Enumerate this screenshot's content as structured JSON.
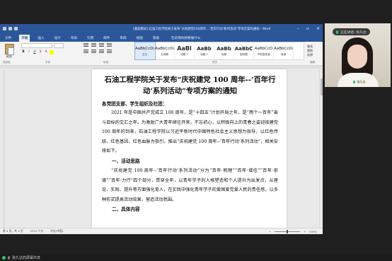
{
  "word": {
    "title": "[兼容模式] 石油工程学院关于发布“庆祝建党100周年…‘百年行动’系列活动”专项方案的通知 - Word",
    "tabs": [
      "文件",
      "开始",
      "插入",
      "设计",
      "布局",
      "引用",
      "邮件",
      "审阅",
      "视图",
      "帮助"
    ],
    "active_tab": "开始",
    "tell_me": "告诉我你想要做什么",
    "ribbon": {
      "paste": "粘贴",
      "clipboard": "剪贴板",
      "font": "字体",
      "paragraph": "段落",
      "styles_group": "样式",
      "editing": [
        "查找",
        "替换",
        "选择"
      ],
      "editing_label": "编辑",
      "styles": [
        {
          "preview": "AaBbCcDd",
          "name": "正文",
          "kind": "normal"
        },
        {
          "preview": "AaBbCcDd",
          "name": "无间隔",
          "kind": "normal"
        },
        {
          "preview": "AaBl",
          "name": "标题 1",
          "kind": "big"
        },
        {
          "preview": "AaBb",
          "name": "标题 2",
          "kind": "mid"
        },
        {
          "preview": "AaBb",
          "name": "标题",
          "kind": "mid"
        },
        {
          "preview": "AaBbC",
          "name": "副标题",
          "kind": "mid"
        },
        {
          "preview": "AaBbCcD",
          "name": "不明显强调",
          "kind": "normal"
        },
        {
          "preview": "AaBbCcDd",
          "name": "强调",
          "kind": "normal"
        }
      ]
    },
    "document": {
      "title_line1": "石油工程学院关于发布“庆祝建党 100 周年--‘百年行",
      "title_line2": "动’系列活动”专项方案的通知",
      "salutation": "各党团支部、学生组织及社团：",
      "paragraph1": "2021 年是中国共产党成立 100 周年，是“十四五”计划开局之年，是“两个一百年”奋斗目标的交汇之年。为激励广大青年继往开来，不忘初心，以积极向上的青春之姿迎接建党 100 周年的到来，石油工程学院以习近平新时代中国特色社会主义思想为指导，以红色传统、红色基因、红色血脉为指引，推出“庆祝建党 100 周年--‘百年行动’系列活动”，相关安排如下。",
      "heading1": "一、活动思路",
      "paragraph2": "“庆祝建党 100 周年--‘百年行动’系列活动”分为“百年·明理”“百年·增信”“百年·崇德”“百年·力行”四个部分，贯穿全年，以青年学子的人格塑造和个人提升为出发点，从理论、实践、提升等方面强化育人，在实践中强化青年学子的爱国爱党爱人民的责任感，以多种形式提高活动效果，营造活动氛围。",
      "heading2": "二、具体内容"
    },
    "status": {
      "page": "第 4 页，共 5 页",
      "words": "2372 个字",
      "lang": "中文(中国)",
      "zoom": "100%"
    }
  },
  "meeting": {
    "speaker_label": "正在讲话: 张久达",
    "participant_name": "张久达",
    "share_label": "张久达的屏幕共享"
  }
}
